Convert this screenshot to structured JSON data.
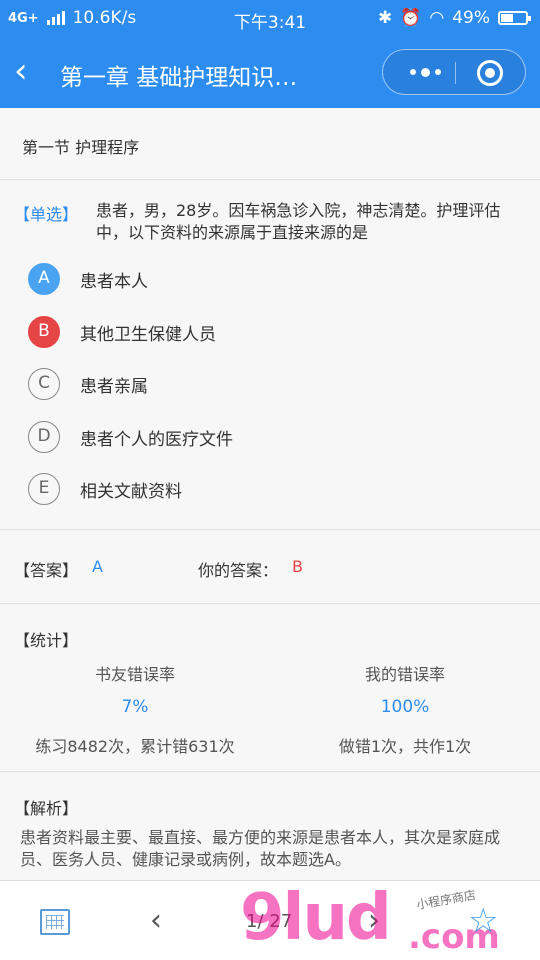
{
  "status_bar": {
    "network": "4G+",
    "speed": "10.6K/s",
    "time": "下午3:41",
    "battery": "49%",
    "battery_level": 0.49
  },
  "nav": {
    "back_icon": "chevron-left-icon",
    "title": "第一章 基础护理知识…",
    "more_icon": "more-dots-icon",
    "close_icon": "target-circle-icon"
  },
  "section": {
    "title": "第一节 护理程序"
  },
  "question": {
    "type_label": "【单选】",
    "text": "患者，男，28岁。因车祸急诊入院，神志清楚。护理评估中，以下资料的来源属于直接来源的是",
    "options": [
      {
        "letter": "A",
        "text": "患者本人",
        "state": "correct"
      },
      {
        "letter": "B",
        "text": "其他卫生保健人员",
        "state": "wrong"
      },
      {
        "letter": "C",
        "text": "患者亲属",
        "state": "normal"
      },
      {
        "letter": "D",
        "text": "患者个人的医疗文件",
        "state": "normal"
      },
      {
        "letter": "E",
        "text": "相关文献资料",
        "state": "normal"
      }
    ]
  },
  "answer": {
    "label": "【答案】",
    "value": "A",
    "your_label": "你的答案：",
    "your_value": "B"
  },
  "stats": {
    "title": "【统计】",
    "friends": {
      "caption": "书友错误率",
      "percent": "7%",
      "detail": "练习8482次，累计错631次"
    },
    "mine": {
      "caption": "我的错误率",
      "percent": "100%",
      "detail": "做错1次，共作1次"
    }
  },
  "analysis": {
    "title": "【解析】",
    "text": "患者资料最主要、最直接、最方便的来源是患者本人，其次是家庭成员、医务人员、健康记录或病例，故本题选A。"
  },
  "bottom": {
    "grid_icon": "grid-list-icon",
    "prev_icon": "chevron-left-icon",
    "page": "1/ 27",
    "next_icon": "chevron-right-icon",
    "star_icon": "star-icon"
  },
  "watermark": {
    "big": "9lud",
    "com": ".com",
    "small": "小程序商店"
  },
  "colors": {
    "primary": "#2d8cf0",
    "correct": "#4aa3f0",
    "wrong": "#e54545"
  }
}
